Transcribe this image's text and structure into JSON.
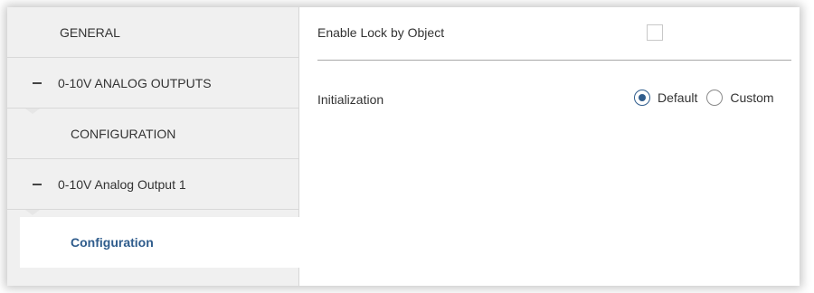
{
  "sidebar": {
    "items": [
      {
        "label": "GENERAL"
      },
      {
        "label": "0-10V ANALOG OUTPUTS",
        "icon": "collapse-dash-icon"
      },
      {
        "label": "CONFIGURATION"
      },
      {
        "label": "0-10V Analog Output 1",
        "icon": "collapse-dash-icon"
      },
      {
        "label": "Configuration",
        "selected": true
      }
    ]
  },
  "main": {
    "lock": {
      "label": "Enable Lock by Object",
      "checked": false
    },
    "initialization": {
      "label": "Initialization",
      "options": [
        {
          "label": "Default",
          "selected": true
        },
        {
          "label": "Custom",
          "selected": false
        }
      ]
    }
  },
  "colors": {
    "accent": "#2f5c8c",
    "sidebar_bg": "#f0f0f0",
    "text": "#333333"
  }
}
